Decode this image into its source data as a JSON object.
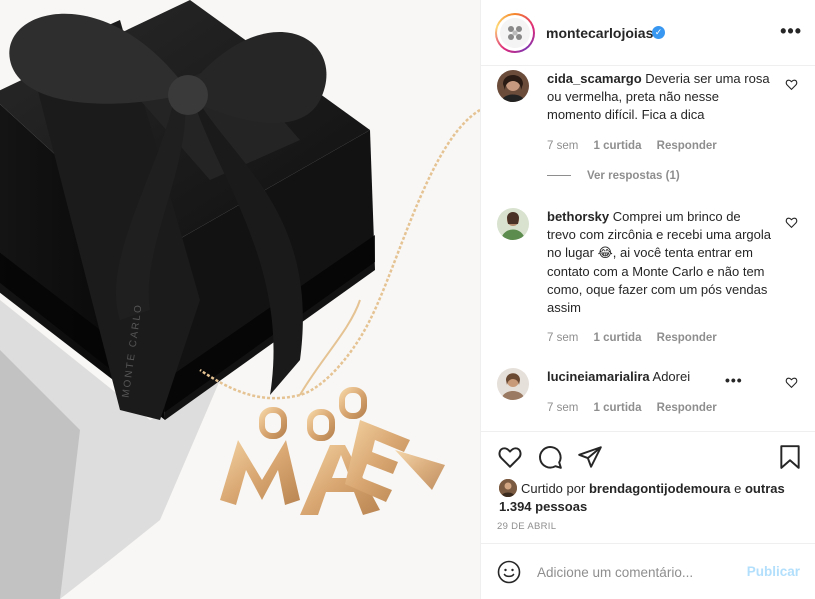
{
  "post": {
    "username": "montecarlojoias",
    "verified_mark": "✓",
    "more_icon": "more-horizontal-icon",
    "photo_alt": "Caixa de presente preta com laço e colar com letras M A E",
    "box_brand_text": "MONTE CARLO"
  },
  "comments": [
    {
      "username": "cida_scamargo",
      "text": "Deveria ser uma rosa ou vermelha, preta não nesse momento difícil. Fica a dica",
      "time": "7 sem",
      "likes": "1 curtida",
      "reply": "Responder",
      "view_replies": "Ver respostas (1)"
    },
    {
      "username": "bethorsky",
      "text": "Comprei um brinco de trevo com zircônia e recebi uma argola no lugar 😂, ai você tenta entrar em contato com a Monte Carlo e não tem como, oque fazer com um pós vendas assim",
      "time": "7 sem",
      "likes": "1 curtida",
      "reply": "Responder"
    },
    {
      "username": "lucineiamarialira",
      "text": "Adorei",
      "time": "7 sem",
      "likes": "1 curtida",
      "reply": "Responder",
      "options": "•••"
    }
  ],
  "likes": {
    "prefix": "Curtido por",
    "user": "brendagontijodemoura",
    "and": "e",
    "others": "outras 1.394 pessoas"
  },
  "date": "29 DE ABRIL",
  "add_comment": {
    "placeholder": "Adicione um comentário...",
    "publish": "Publicar"
  },
  "colors": {
    "link_blue": "#3897f0",
    "publish_disabled": "#b2dffc",
    "muted": "#8e8e8e",
    "text": "#262626"
  }
}
